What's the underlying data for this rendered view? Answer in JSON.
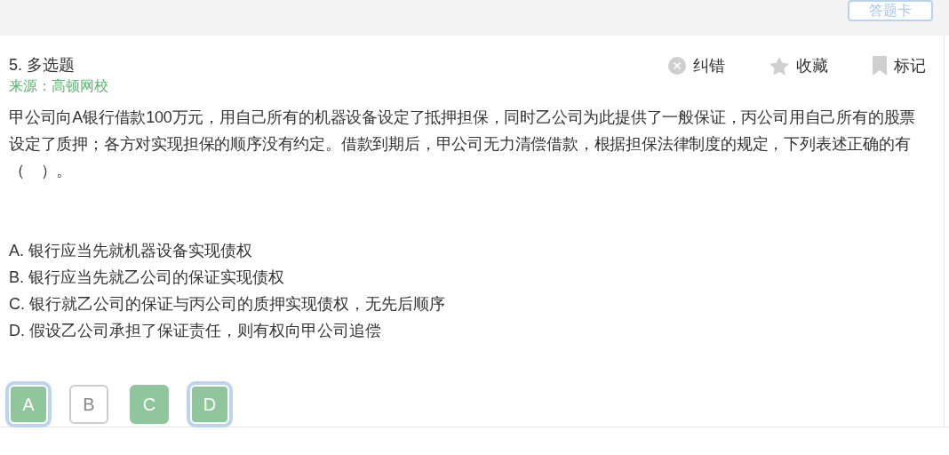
{
  "header": {
    "answer_card_button": "答题卡"
  },
  "question": {
    "number_type": "5. 多选题",
    "source": "来源：高顿网校",
    "actions": [
      {
        "kind": "report",
        "label": "纠错"
      },
      {
        "kind": "favorite",
        "label": "收藏"
      },
      {
        "kind": "mark",
        "label": "标记"
      }
    ],
    "stem": "甲公司向A银行借款100万元，用自己所有的机器设备设定了抵押担保，同时乙公司为此提供了一般保证，丙公司用自己所有的股票设定了质押；各方对实现担保的顺序没有约定。借款到期后，甲公司无力清偿借款，根据担保法律制度的规定，下列表述正确的有（　）。",
    "options": [
      "A. 银行应当先就机器设备实现债权",
      "B. 银行应当先就乙公司的保证实现债权",
      "C. 银行就乙公司的保证与丙公司的质押实现债权，无先后顺序",
      "D. 假设乙公司承担了保证责任，则有权向甲公司追偿"
    ],
    "answer_buttons": [
      {
        "label": "A",
        "correct": true,
        "selected": true
      },
      {
        "label": "B",
        "correct": false,
        "selected": false
      },
      {
        "label": "C",
        "correct": true,
        "selected": false
      },
      {
        "label": "D",
        "correct": true,
        "selected": true
      }
    ]
  }
}
